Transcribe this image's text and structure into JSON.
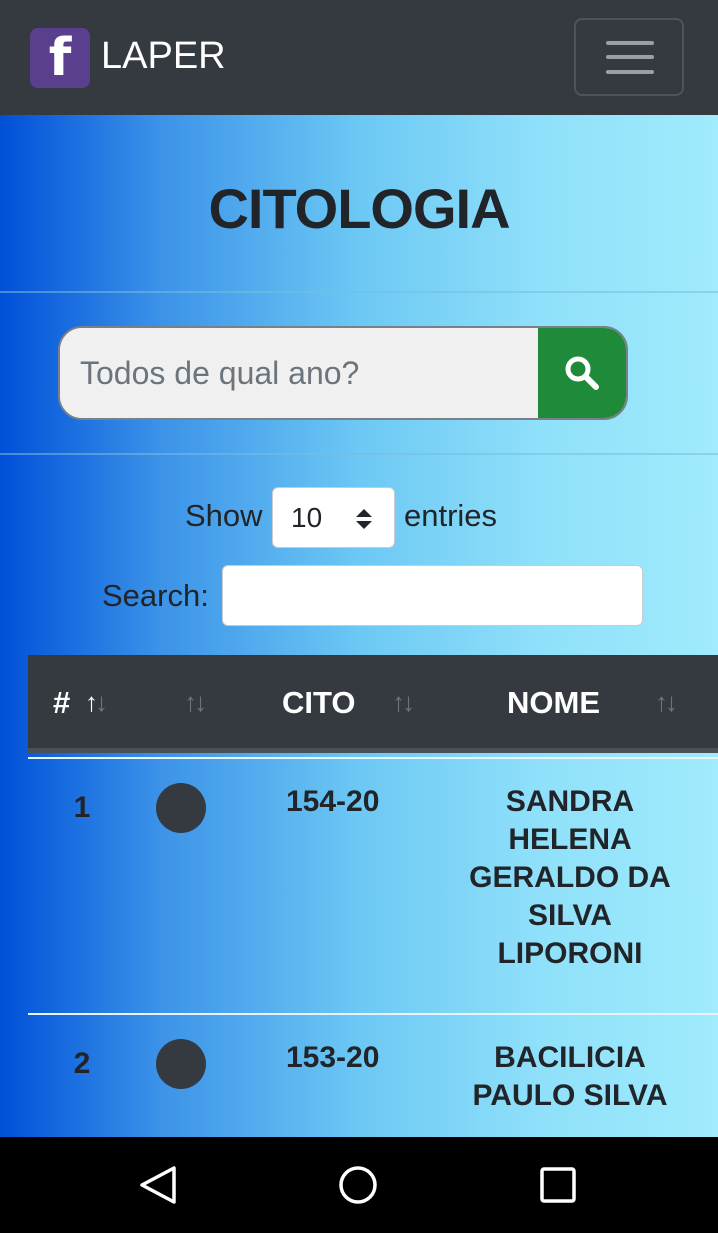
{
  "navbar": {
    "brand_letter": "f",
    "brand_name": "LAPER",
    "menu_icon": "hamburger-icon"
  },
  "page": {
    "title": "CITOLOGIA"
  },
  "search": {
    "placeholder": "Todos de qual ano?",
    "button_icon": "search-icon"
  },
  "entries": {
    "show_label": "Show",
    "value": "10",
    "entries_label": "entries"
  },
  "filter": {
    "label": "Search:",
    "value": ""
  },
  "table": {
    "headers": [
      "#",
      "",
      "CITO",
      "NOME"
    ],
    "rows": [
      {
        "num": "1",
        "cito": "154-20",
        "nome": "SANDRA HELENA GERALDO DA SILVA LIPORONI"
      },
      {
        "num": "2",
        "cito": "153-20",
        "nome": "BACILICIA PAULO SILVA"
      }
    ]
  },
  "colors": {
    "navbar": "#343a40",
    "search_button": "#1e8a3a",
    "brand_logo": "#5a3f8f"
  },
  "system_nav": {
    "icons": [
      "back-icon",
      "home-icon",
      "recents-icon"
    ]
  }
}
